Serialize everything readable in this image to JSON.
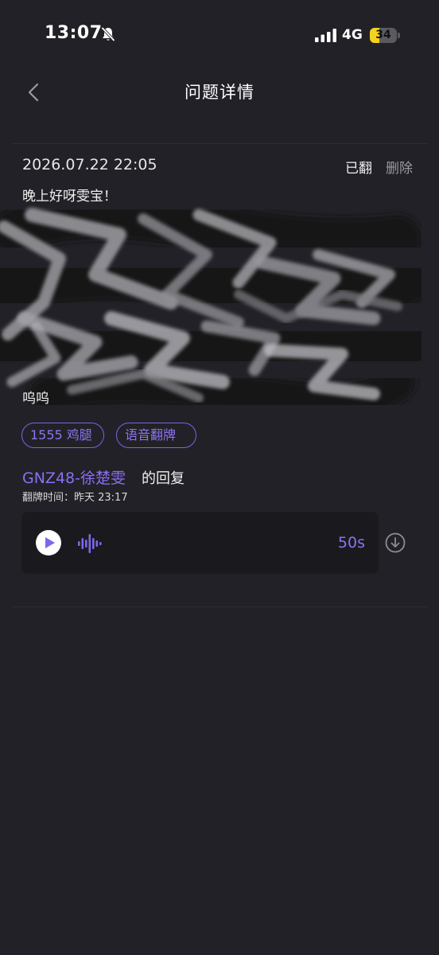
{
  "status_bar": {
    "time": "13:07",
    "network": "4G",
    "battery_level": "34",
    "battery_fraction": 0.34
  },
  "nav": {
    "title": "问题详情",
    "back_icon": "chevron-left-icon"
  },
  "question": {
    "date": "2026.07.22 22:05",
    "status": "已翻",
    "delete_label": "删除",
    "text_head": "晚上好呀雯宝！",
    "text_tail": "呜呜"
  },
  "tags": [
    {
      "label": "1555 鸡腿"
    },
    {
      "label": "语音翻牌"
    }
  ],
  "reply": {
    "author": "GNZ48-徐楚雯",
    "suffix": "的回复",
    "time_label": "翻牌时间：昨天 23:17",
    "duration": "50s"
  },
  "colors": {
    "background": "#222127",
    "accent": "#8d73f2",
    "player_bg": "#1a191e"
  }
}
